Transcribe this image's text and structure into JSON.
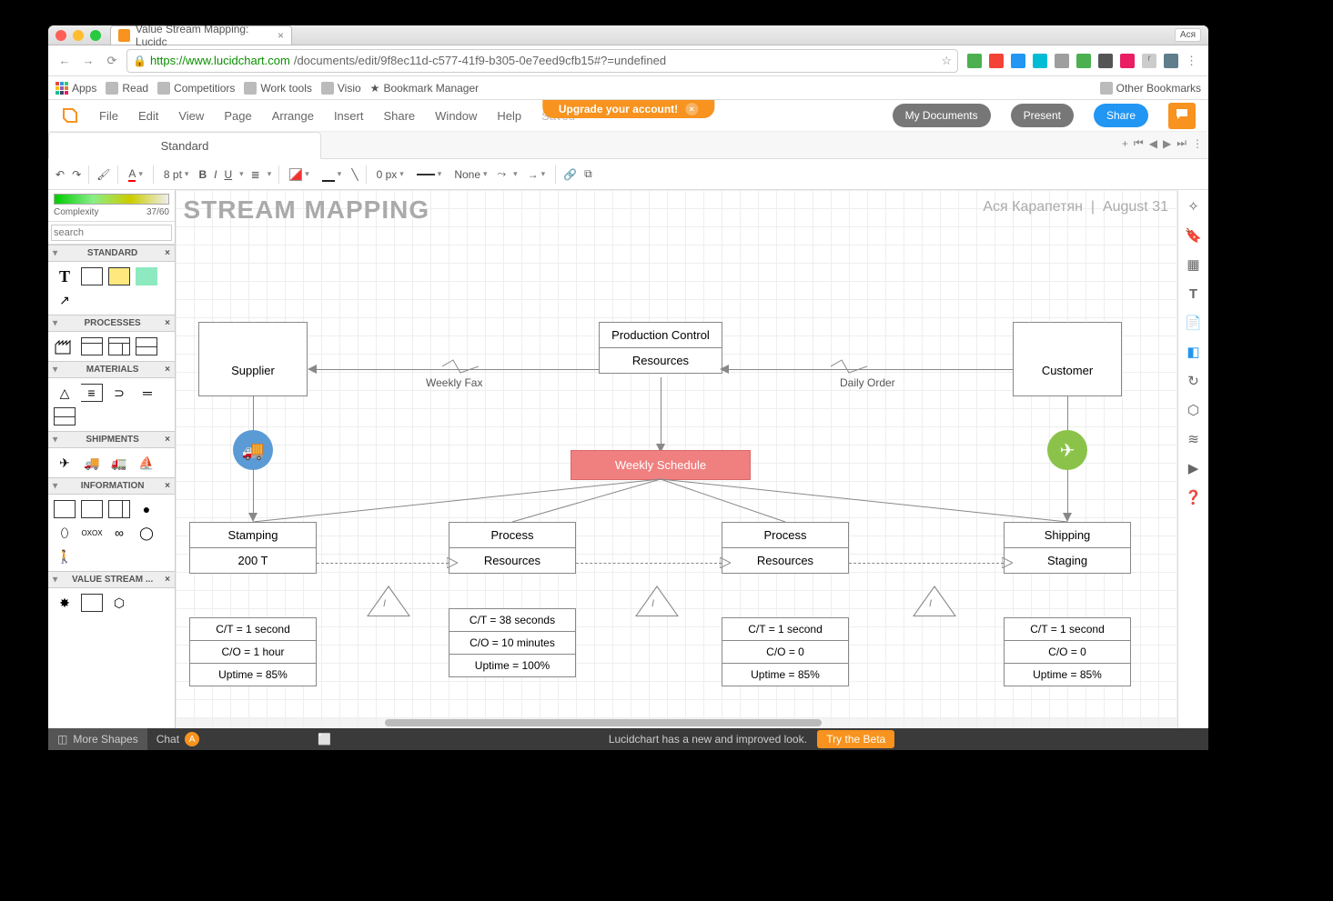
{
  "browser": {
    "tab_title": "Value Stream Mapping: Lucidc",
    "profile": "Aся",
    "url_secure": "https://www.lucidchart.com",
    "url_path": "/documents/edit/9f8ec11d-c577-41f9-b305-0e7eed9cfb15#?=undefined",
    "bookmarks": [
      "Apps",
      "Read",
      "Competitiors",
      "Work tools",
      "Visio",
      "Bookmark Manager"
    ],
    "other_bookmarks": "Other Bookmarks"
  },
  "banner": {
    "text": "Upgrade your account!"
  },
  "menu": {
    "items": [
      "File",
      "Edit",
      "View",
      "Page",
      "Arrange",
      "Insert",
      "Share",
      "Window",
      "Help"
    ],
    "saved": "Saved",
    "mydocs": "My Documents",
    "present": "Present",
    "share": "Share"
  },
  "doctab": "Standard",
  "toolbar": {
    "fontsize": "8 pt",
    "borderpx": "0 px",
    "linestyle": "None"
  },
  "sidebar": {
    "complexity_label": "Complexity",
    "complexity_val": "37/60",
    "search_placeholder": "search",
    "sections": [
      "STANDARD",
      "PROCESSES",
      "MATERIALS",
      "SHIPMENTS",
      "INFORMATION",
      "VALUE STREAM ..."
    ],
    "more_shapes": "More Shapes"
  },
  "canvas": {
    "title": "E STREAM MAPPING",
    "author": "Ася Карапетян",
    "date": "August 31",
    "supplier": "Supplier",
    "customer": "Customer",
    "prodctrl": {
      "title": "Production Control",
      "sub": "Resources"
    },
    "schedule": "Weekly Schedule",
    "weekly_fax": "Weekly Fax",
    "daily_order": "Daily Order",
    "processes": [
      {
        "name": "Stamping",
        "sub": "200 T",
        "data": [
          "C/T = 1 second",
          "C/O = 1 hour",
          "Uptime = 85%"
        ]
      },
      {
        "name": "Process",
        "sub": "Resources",
        "data": [
          "C/T = 38 seconds",
          "C/O = 10 minutes",
          "Uptime = 100%"
        ]
      },
      {
        "name": "Process",
        "sub": "Resources",
        "data": [
          "C/T = 1 second",
          "C/O = 0",
          "Uptime = 85%"
        ]
      },
      {
        "name": "Shipping",
        "sub": "Staging",
        "data": [
          "C/T = 1 second",
          "C/O = 0",
          "Uptime = 85%"
        ]
      }
    ]
  },
  "footer": {
    "chat": "Chat",
    "msg": "Lucidchart has a new and improved look.",
    "beta": "Try the Beta"
  }
}
